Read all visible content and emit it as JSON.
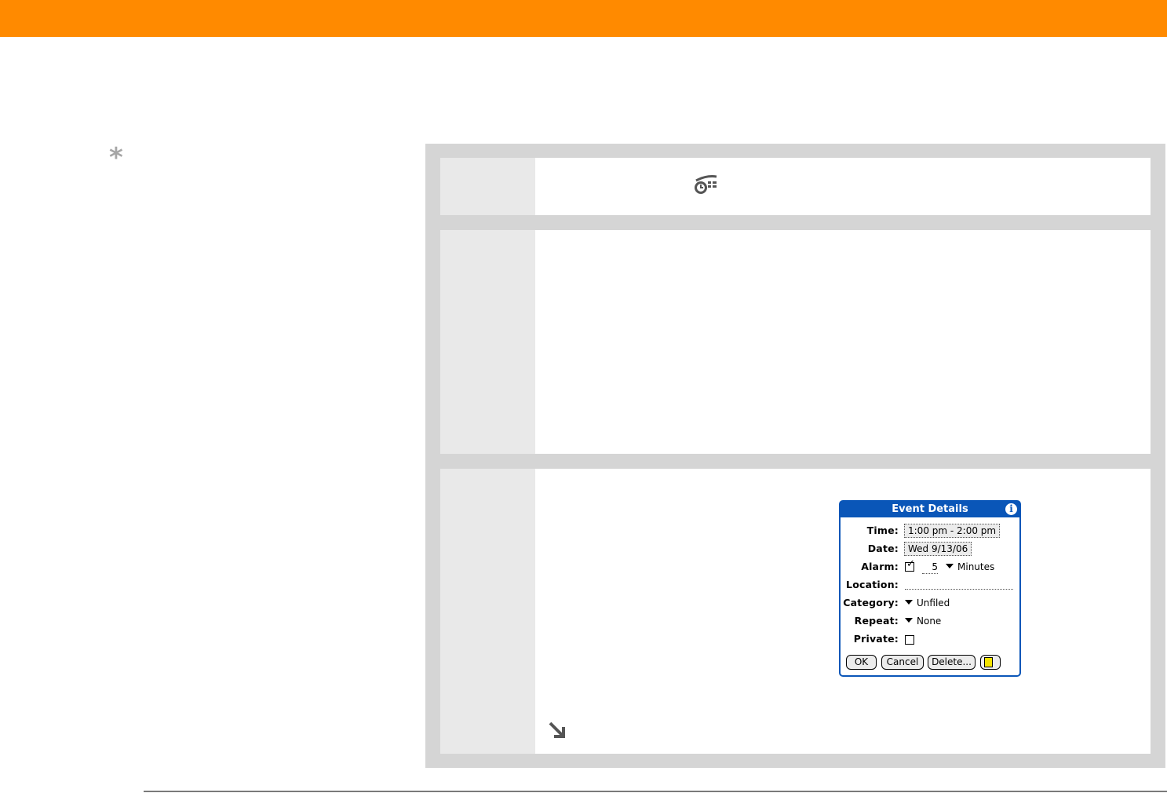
{
  "header": {
    "accent_color": "#ff8a00"
  },
  "tip": {
    "icon": "asterisk-icon",
    "glyph": "*"
  },
  "steps": [
    {
      "id": "step-1",
      "icon": "alarm-clock-icon"
    },
    {
      "id": "step-2"
    },
    {
      "id": "step-3",
      "continue_icon": "continue-arrow-icon"
    }
  ],
  "event_details": {
    "title": "Event Details",
    "info_glyph": "i",
    "time_label": "Time:",
    "time_value": "1:00 pm - 2:00 pm",
    "date_label": "Date:",
    "date_value": "Wed 9/13/06",
    "alarm_label": "Alarm:",
    "alarm_checked": true,
    "alarm_amount": "5",
    "alarm_unit": "Minutes",
    "location_label": "Location:",
    "location_value": "",
    "category_label": "Category:",
    "category_value": "Unfiled",
    "repeat_label": "Repeat:",
    "repeat_value": "None",
    "private_label": "Private:",
    "private_checked": false,
    "buttons": {
      "ok": "OK",
      "cancel": "Cancel",
      "delete": "Delete..."
    },
    "note_icon": "note-icon",
    "title_color": "#0a56b8"
  }
}
